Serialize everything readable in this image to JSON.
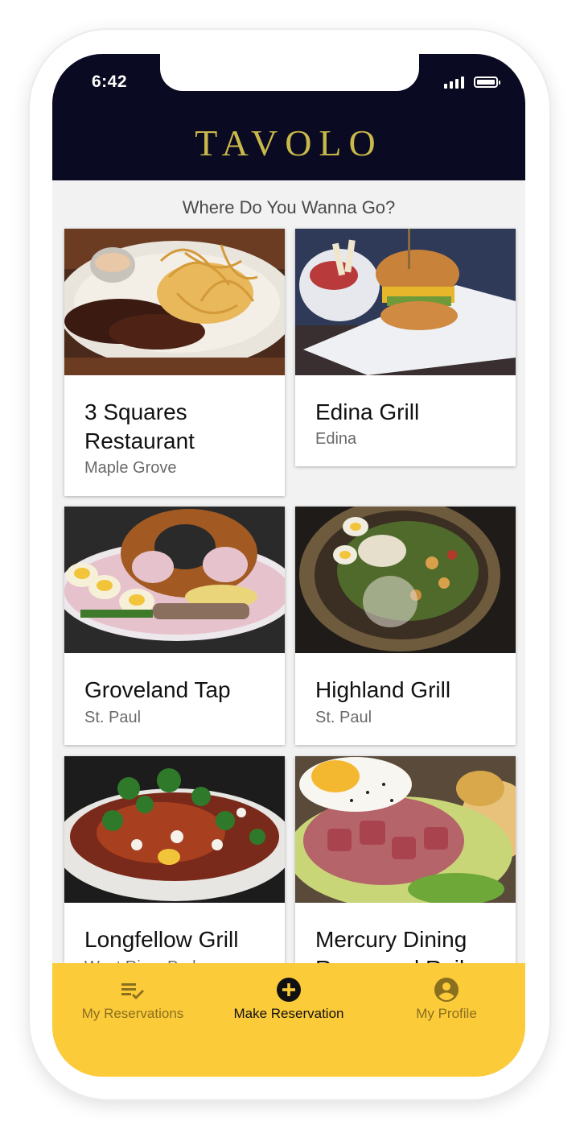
{
  "status_bar": {
    "time": "6:42"
  },
  "header": {
    "logo_text": "TAVOLO"
  },
  "main": {
    "subtitle": "Where Do You Wanna Go?",
    "restaurants": [
      {
        "name": "3 Squares Restaurant",
        "city": "Maple Grove"
      },
      {
        "name": "Edina Grill",
        "city": "Edina"
      },
      {
        "name": "Groveland Tap",
        "city": "St. Paul"
      },
      {
        "name": "Highland Grill",
        "city": "St. Paul"
      },
      {
        "name": "Longfellow Grill",
        "city": "West River Parkway"
      },
      {
        "name": "Mercury Dining Room and Rail",
        "city": ""
      }
    ]
  },
  "bottom_nav": {
    "items": [
      {
        "label": "My Reservations",
        "icon": "list-check-icon",
        "active": false
      },
      {
        "label": "Make Reservation",
        "icon": "add-circle-icon",
        "active": true
      },
      {
        "label": "My Profile",
        "icon": "account-circle-icon",
        "active": false
      }
    ]
  },
  "colors": {
    "header_bg": "#0b0a23",
    "logo": "#c9b94a",
    "nav_bg": "#fccb3a",
    "nav_active": "#111111",
    "nav_inactive": "#8a6f1e"
  }
}
